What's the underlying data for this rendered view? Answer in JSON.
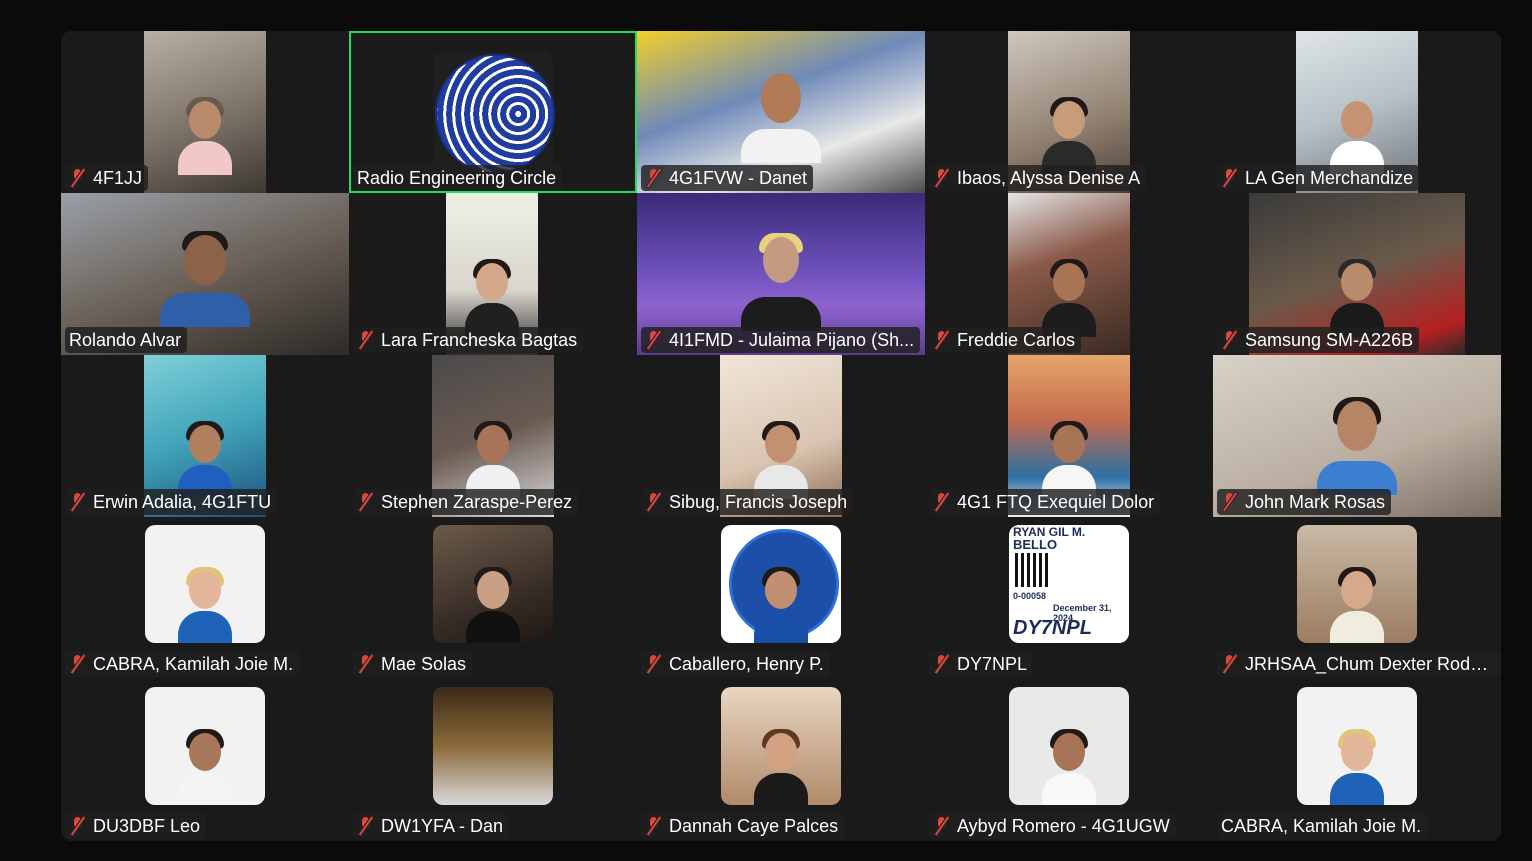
{
  "accent_active": "#23d96a",
  "muted_color": "#e0443e",
  "participants": [
    {
      "name": "4F1JJ",
      "muted": true
    },
    {
      "name": "Radio Engineering Circle",
      "muted": false,
      "active": true
    },
    {
      "name": "4G1FVW - Danet",
      "muted": true
    },
    {
      "name": "Ibaos, Alyssa Denise A",
      "muted": true
    },
    {
      "name": "LA Gen Merchandize",
      "muted": true
    },
    {
      "name": "Rolando Alvar",
      "muted": false
    },
    {
      "name": "Lara Francheska Bagtas",
      "muted": true
    },
    {
      "name": "4I1FMD - Julaima Pijano (Sh...",
      "muted": true
    },
    {
      "name": "Freddie Carlos",
      "muted": true
    },
    {
      "name": "Samsung SM-A226B",
      "muted": true
    },
    {
      "name": "Erwin Adalia, 4G1FTU",
      "muted": true
    },
    {
      "name": "Stephen Zaraspe-Perez",
      "muted": true
    },
    {
      "name": "Sibug, Francis Joseph",
      "muted": true
    },
    {
      "name": "4G1 FTQ Exequiel Dolor",
      "muted": true
    },
    {
      "name": "John Mark Rosas",
      "muted": true
    },
    {
      "name": "CABRA, Kamilah Joie M.",
      "muted": true
    },
    {
      "name": "Mae Solas",
      "muted": true
    },
    {
      "name": "Caballero, Henry P.",
      "muted": true
    },
    {
      "name": "DY7NPL",
      "muted": true
    },
    {
      "name": "JRHSAA_Chum Dexter Roder...",
      "muted": true
    },
    {
      "name": "DU3DBF Leo",
      "muted": true
    },
    {
      "name": "DW1YFA - Dan",
      "muted": true
    },
    {
      "name": "Dannah Caye Palces",
      "muted": true
    },
    {
      "name": "Aybyd Romero - 4G1UGW",
      "muted": true
    },
    {
      "name": "CABRA, Kamilah Joie M.",
      "muted": false
    }
  ],
  "id_card": {
    "name_line": "RYAN GIL M.",
    "surname_line": "BELLO",
    "number": "0-00058",
    "valid_until": "December 31, 2024",
    "callsign": "DY7NPL"
  }
}
